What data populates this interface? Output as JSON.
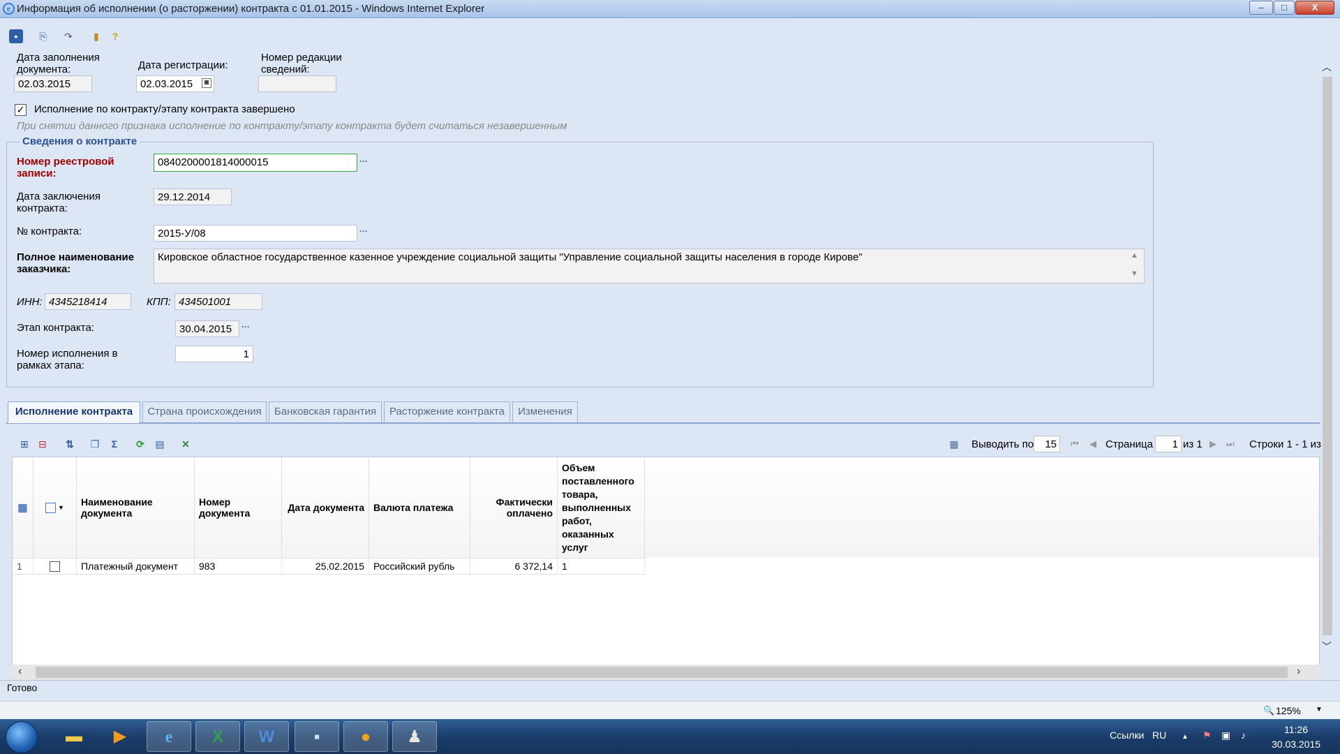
{
  "window": {
    "title": "Информация об исполнении (о расторжении) контракта с 01.01.2015 - Windows Internet Explorer",
    "min_label": "–",
    "max_label": "□",
    "close_label": "X"
  },
  "toolbar": {
    "icons": [
      "save-icon",
      "export-icon",
      "redo-icon",
      "copy-icon",
      "help-icon"
    ]
  },
  "header": {
    "fill_date_label": "Дата заполнения документа:",
    "fill_date": "02.03.2015",
    "reg_date_label": "Дата регистрации:",
    "reg_date": "02.03.2015",
    "edition_label": "Номер редакции сведений:",
    "edition_value": ""
  },
  "completion": {
    "checked": true,
    "label": "Исполнение по контракту/этапу контракта завершено",
    "hint": "При снятии данного признака исполнение по контракту/этапу контракта будет считаться незавершенным"
  },
  "contract": {
    "group_title": "Сведения о контракте",
    "registry_label": "Номер реестровой записи:",
    "registry_value": "0840200001814000015",
    "conclusion_label": "Дата заключения контракта:",
    "conclusion_value": "29.12.2014",
    "number_label": "№ контракта:",
    "number_value": "2015-У/08",
    "customer_label": "Полное наименование заказчика:",
    "customer_value": "Кировское областное государственное казенное учреждение социальной защиты \"Управление социальной защиты населения в городе Кирове\"",
    "inn_label": "ИНН:",
    "inn_value": "4345218414",
    "kpp_label": "КПП:",
    "kpp_value": "434501001",
    "stage_label": "Этап контракта:",
    "stage_value": "30.04.2015",
    "exec_number_label": "Номер исполнения в рамках этапа:",
    "exec_number_value": "1",
    "dots": "···"
  },
  "tabs": [
    {
      "label": "Исполнение контракта",
      "active": true
    },
    {
      "label": "Страна происхождения",
      "active": false
    },
    {
      "label": "Банковская гарантия",
      "active": false
    },
    {
      "label": "Расторжение контракта",
      "active": false
    },
    {
      "label": "Изменения",
      "active": false
    }
  ],
  "pager": {
    "show_label": "Выводить по",
    "page_size": "15",
    "page_label": "Страница",
    "page": "1",
    "of_label": "из 1",
    "rows_label": "Строки 1 - 1 из"
  },
  "grid": {
    "columns": [
      "Наименование документа",
      "Номер документа",
      "Дата документа",
      "Валюта платежа",
      "Фактически оплачено",
      "Объем поставленного товара, выполненных работ, оказанных услуг"
    ],
    "rows": [
      {
        "num": "1",
        "name": "Платежный документ",
        "doc_number": "983",
        "date": "25.02.2015",
        "currency": "Российский рубль",
        "paid": "6 372,14",
        "volume": "1"
      }
    ]
  },
  "status": {
    "text": "Готово",
    "zoom": "125%"
  },
  "taskbar": {
    "links_label": "Ссылки",
    "lang": "RU",
    "time": "11:26",
    "date": "30.03.2015"
  },
  "colors": {
    "required_label": "#a00000",
    "group_title": "#2b5192",
    "active_field_border": "#2eaa3a"
  }
}
